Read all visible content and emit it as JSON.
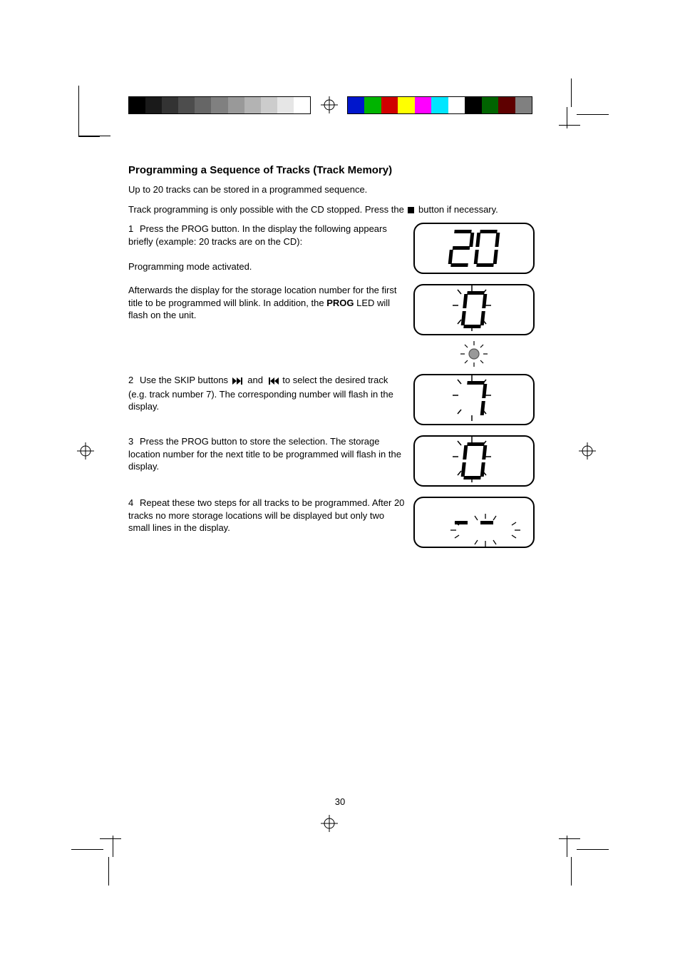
{
  "title": "Programming a Sequence of Tracks (Track Memory)",
  "intro1": "Up to 20 tracks can be stored in a programmed sequence.",
  "intro2_a": "Track programming is only possible with the CD stopped. Press the ",
  "intro2_b": " button if necessary.",
  "step1": {
    "num": "1",
    "text": "Press the PROG button. In the display the following appears briefly (example: 20 tracks are on the CD):",
    "display_note": "Programming mode activated."
  },
  "step1b": {
    "text_a": "Afterwards the display for the storage location number for the first title to be programmed will blink. In addition, the ",
    "text_b": " LED will flash on the unit.",
    "led_label": "PROG"
  },
  "step2": {
    "num": "2",
    "text_a": "Use the SKIP buttons ",
    "text_b": " and ",
    "text_c": " to select the desired track (e.g. track number 7). The corresponding number will flash in the display."
  },
  "step3": {
    "num": "3",
    "text": "Press the PROG button to store the selection. The storage location number for the next title to be programmed will flash in the display."
  },
  "step4": {
    "num": "4",
    "text": "Repeat these two steps for all tracks to be programmed. After 20 tracks no more storage locations will be displayed but only two small lines in the display."
  },
  "footer": "30",
  "displays": {
    "d1": "20",
    "d2": "0",
    "d3": "7",
    "d4": "0",
    "d5": "--"
  }
}
